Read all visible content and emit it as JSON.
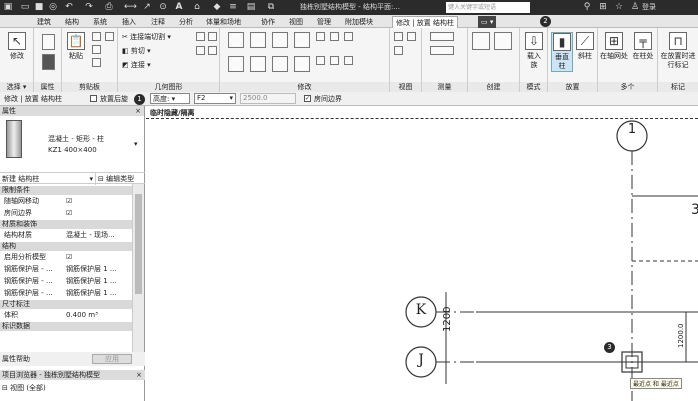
{
  "qat": {
    "title": "独栋别墅结构模型 - 结构平面:...",
    "search_placeholder": "键入关键字或短语",
    "login": "登录"
  },
  "tabs": [
    "建筑",
    "结构",
    "系统",
    "插入",
    "注释",
    "分析",
    "体量和场地",
    "协作",
    "视图",
    "管理",
    "附加模块",
    "修改 | 放置 结构柱"
  ],
  "ribbon": {
    "select": {
      "btn": "修改",
      "label": "选择 ▾"
    },
    "properties": {
      "label": "属性"
    },
    "clipboard": {
      "paste": "粘贴",
      "label": "剪贴板"
    },
    "geometry": {
      "cut": "连接端切割 ▾",
      "cut2": "剪切 ▾",
      "join": "连接 ▾",
      "label": "几何图形"
    },
    "modify": {
      "label": "修改"
    },
    "view": {
      "label": "视图"
    },
    "measure": {
      "label": "测量"
    },
    "create": {
      "label": "创建"
    },
    "mode": {
      "load": "载入族",
      "label": "模式"
    },
    "place": {
      "vertical": "垂直柱",
      "slanted": "斜柱",
      "label": "放置"
    },
    "multiple": {
      "at_grid": "在轴网处",
      "at_column": "在柱处",
      "label": "多个"
    },
    "tag": {
      "tag_on_place": "在放置时进行标记",
      "label": "标记"
    }
  },
  "options_bar": {
    "context": "修改 | 放置 结构柱",
    "rotate_after": "放置后旋",
    "depth_label": "高度:",
    "level": "F2",
    "offset": "2500.0",
    "room_bounding": "房间边界"
  },
  "badges": [
    "1",
    "2",
    "3"
  ],
  "properties": {
    "header": "属性",
    "family": "混凝土 - 矩形 - 柱",
    "type": "KZ1 400×400",
    "selector": "新建 结构柱",
    "edit_type": "编辑类型",
    "rows": [
      {
        "kind": "section",
        "text": "限制条件"
      },
      {
        "kind": "row",
        "k": "随轴网移动",
        "v": "☑"
      },
      {
        "kind": "row",
        "k": "房间边界",
        "v": "☑"
      },
      {
        "kind": "section",
        "text": "材质和装饰"
      },
      {
        "kind": "row",
        "k": "结构材质",
        "v": "混凝土 - 现场..."
      },
      {
        "kind": "section",
        "text": "结构"
      },
      {
        "kind": "row",
        "k": "启用分析模型",
        "v": "☑"
      },
      {
        "kind": "row",
        "k": "钢筋保护层 - ...",
        "v": "钢筋保护层 1 ..."
      },
      {
        "kind": "row",
        "k": "钢筋保护层 - ...",
        "v": "钢筋保护层 1 ..."
      },
      {
        "kind": "row",
        "k": "钢筋保护层 - ...",
        "v": "钢筋保护层 1 ..."
      },
      {
        "kind": "section",
        "text": "尺寸标注"
      },
      {
        "kind": "row",
        "k": "体积",
        "v": "0.400 m³"
      },
      {
        "kind": "section",
        "text": "标识数据"
      }
    ],
    "help": "属性帮助",
    "apply": "应用"
  },
  "browser": {
    "header": "项目浏览器 - 独栋别墅结构模型",
    "root": "视图 (全部)"
  },
  "canvas": {
    "banner": "临时隐藏/隔离",
    "grid_1": "1",
    "grid_k": "K",
    "grid_j": "J",
    "grid_3": "3",
    "dim_1200": "1200",
    "dim_1200b": "1200.0",
    "snap_tip": "最近点 和 最近点"
  }
}
